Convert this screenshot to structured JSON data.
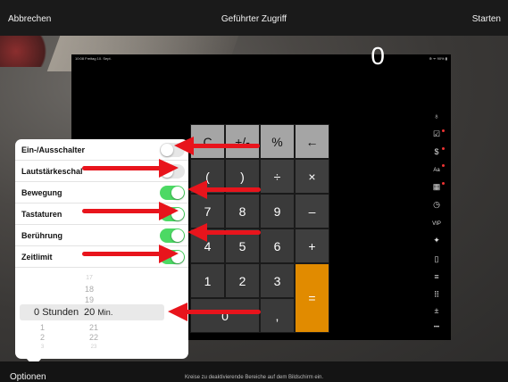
{
  "topbar": {
    "cancel": "Abbrechen",
    "title": "Geführter Zugriff",
    "start": "Starten"
  },
  "ipad": {
    "status_left": "10:08 Freitag 10. Sept.",
    "status_right": "⊕ ᯤ 90% ▮",
    "display": "0"
  },
  "calculator": {
    "keys": [
      {
        "label": "C",
        "type": "fn"
      },
      {
        "label": "+/-",
        "type": "fn"
      },
      {
        "label": "%",
        "type": "fn"
      },
      {
        "label": "←",
        "type": "fn"
      },
      {
        "label": "(",
        "type": "num"
      },
      {
        "label": ")",
        "type": "num"
      },
      {
        "label": "÷",
        "type": "op"
      },
      {
        "label": "×",
        "type": "op"
      },
      {
        "label": "7",
        "type": "num"
      },
      {
        "label": "8",
        "type": "num"
      },
      {
        "label": "9",
        "type": "num"
      },
      {
        "label": "–",
        "type": "op"
      },
      {
        "label": "4",
        "type": "num"
      },
      {
        "label": "5",
        "type": "num"
      },
      {
        "label": "6",
        "type": "num"
      },
      {
        "label": "+",
        "type": "op"
      },
      {
        "label": "1",
        "type": "num"
      },
      {
        "label": "2",
        "type": "num"
      },
      {
        "label": "3",
        "type": "num"
      },
      {
        "label": "=",
        "type": "eq"
      },
      {
        "label": "0",
        "type": "num"
      },
      {
        "label": ",",
        "type": "num"
      }
    ]
  },
  "sidebar_icons": [
    {
      "icon": "scientific-icon",
      "glyph": "♁"
    },
    {
      "icon": "history-icon",
      "glyph": "☑"
    },
    {
      "icon": "currency-icon",
      "glyph": "$"
    },
    {
      "icon": "text-size-icon",
      "glyph": "Aa"
    },
    {
      "icon": "grid-icon",
      "glyph": "▦"
    },
    {
      "icon": "clock-icon",
      "glyph": "◷"
    },
    {
      "icon": "vip-icon",
      "glyph": "VIP"
    },
    {
      "icon": "star-icon",
      "glyph": "✦"
    },
    {
      "icon": "phone-icon",
      "glyph": "▯"
    },
    {
      "icon": "list-icon",
      "glyph": "≡"
    },
    {
      "icon": "keypad-icon",
      "glyph": "⠿"
    },
    {
      "icon": "operators-icon",
      "glyph": "±"
    },
    {
      "icon": "more-icon",
      "glyph": "•••"
    }
  ],
  "options": {
    "rows": [
      {
        "label": "Ein-/Ausschalter",
        "on": false
      },
      {
        "label": "Lautstärkeschal",
        "on": false
      },
      {
        "label": "Bewegung",
        "on": true
      },
      {
        "label": "Tastaturen",
        "on": true
      },
      {
        "label": "Berührung",
        "on": true
      },
      {
        "label": "Zeitlimit",
        "on": true
      }
    ],
    "timer": {
      "hours_label": "Stunden",
      "hours_value": "0",
      "minutes_label": "Min.",
      "minutes_value": "20",
      "hours_below": [
        "1",
        "2",
        "3"
      ],
      "minutes_above": [
        "17",
        "18",
        "19"
      ],
      "minutes_below": [
        "21",
        "22",
        "23"
      ]
    }
  },
  "bottombar": {
    "options": "Optionen",
    "hint": "Kreise zu deaktivierende Bereiche auf dem Bildschirm ein."
  },
  "colors": {
    "toggle_on": "#4cd964",
    "accent_orange": "#e18b00",
    "arrow_red": "#e8141c"
  }
}
